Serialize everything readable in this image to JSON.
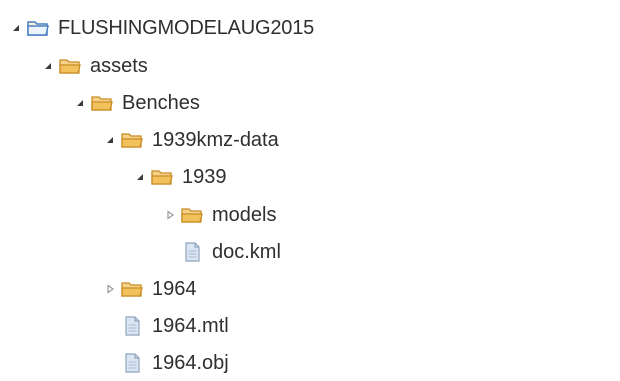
{
  "tree": {
    "root": {
      "label": "FLUSHINGMODELAUG2015",
      "expanded": true,
      "icon": "project-folder-icon"
    },
    "assets": {
      "label": "assets",
      "expanded": true,
      "icon": "folder-open-icon"
    },
    "benches": {
      "label": "Benches",
      "expanded": true,
      "icon": "folder-open-icon"
    },
    "kmz_data": {
      "label": "1939kmz-data",
      "expanded": true,
      "icon": "folder-open-icon"
    },
    "folder_1939": {
      "label": "1939",
      "expanded": true,
      "icon": "folder-open-icon"
    },
    "models": {
      "label": "models",
      "expanded": false,
      "icon": "folder-open-icon"
    },
    "doc_kml": {
      "label": "doc.kml",
      "icon": "file-icon"
    },
    "folder_1964": {
      "label": "1964",
      "expanded": false,
      "icon": "folder-open-icon"
    },
    "file_1964_mtl": {
      "label": "1964.mtl",
      "icon": "file-icon"
    },
    "file_1964_obj": {
      "label": "1964.obj",
      "icon": "file-icon"
    }
  },
  "colors": {
    "folder_fill": "#f2c15c",
    "folder_stroke": "#c98c22",
    "project_folder_stroke": "#4a7fc1",
    "file_fill": "#dbe6f2",
    "file_stroke": "#8fa5bf",
    "twisty_expanded": "#3a3a3a",
    "twisty_collapsed": "#9b9b9b",
    "text": "#2f2f2f"
  }
}
